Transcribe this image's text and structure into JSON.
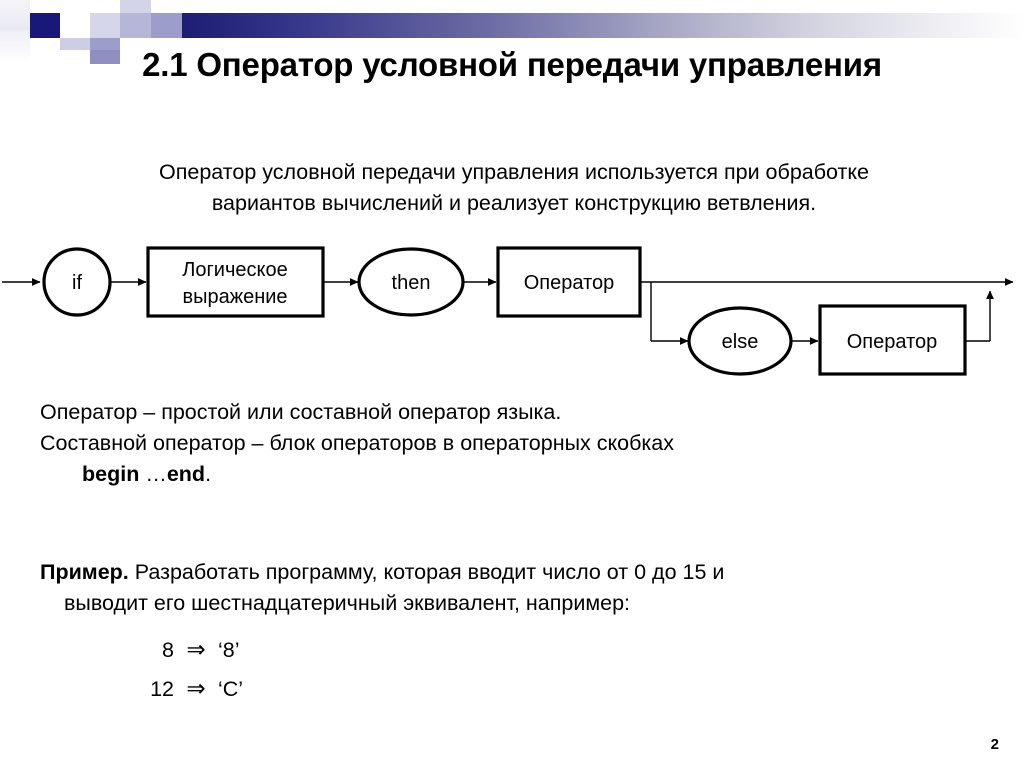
{
  "slide": {
    "title": "2.1 Оператор условной передачи управления",
    "page_number": "2",
    "accent_color": "#1d1d72",
    "deco_light": "#c5c5e0",
    "deco_pale": "#e6e6f2"
  },
  "intro": {
    "line1": "Оператор условной передачи управления используется при обработке",
    "line2": "вариантов вычислений и реализует конструкцию ветвления."
  },
  "diagram": {
    "type": "syntax-railroad-diagram",
    "nodes": {
      "if": "if",
      "condition_line1": "Логическое",
      "condition_line2": "выражение",
      "then": "then",
      "statement_then": "Оператор",
      "else": "else",
      "statement_else": "Оператор"
    }
  },
  "definitions": {
    "line1": "Оператор – простой или составной оператор языка.",
    "line2": "Составной оператор – блок операторов в операторных скобках",
    "line3_bold1": "begin",
    "line3_mid": " …",
    "line3_bold2": "end",
    "line3_tail": "."
  },
  "example": {
    "label": "Пример.",
    "line1": " Разработать программу, которая вводит число от 0 до 15 и",
    "line2": "выводит его шестнадцатеричный эквивалент, например:",
    "rows": [
      {
        "input": "8",
        "arrow": "⇒",
        "output": "‘8’"
      },
      {
        "input": "12",
        "arrow": "⇒",
        "output": "‘C’"
      }
    ]
  }
}
